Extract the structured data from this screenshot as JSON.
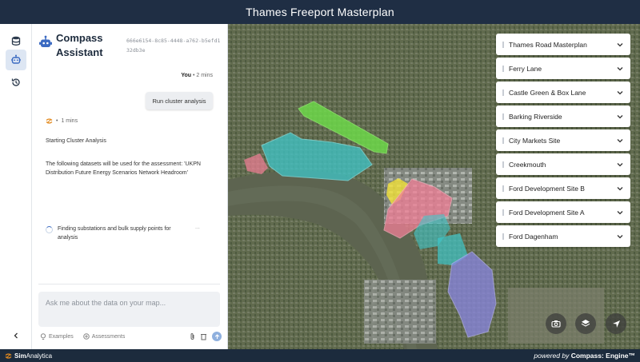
{
  "app": {
    "title": "Thames Freeport Masterplan"
  },
  "assistant": {
    "title": "Compass Assistant",
    "session_id": "666e6154-8c85-4448-a762-b5efd132db3e"
  },
  "conversation": {
    "user": {
      "author": "You",
      "time": "2 mins",
      "message": "Run cluster analysis"
    },
    "bot": {
      "time": "1 mins",
      "heading": "Starting Cluster Analysis",
      "body": "The following datasets will be used for the assessment: 'UKPN Distribution Future Energy Scenarios Network Headroom'",
      "step": "Finding substations and bulk supply points for analysis",
      "step_status": "..."
    }
  },
  "chat_input": {
    "placeholder": "Ask me about the data on your map...",
    "value": "",
    "examples_label": "Examples",
    "assessments_label": "Assessments"
  },
  "sites": [
    {
      "label": "Thames Road Masterplan"
    },
    {
      "label": "Ferry Lane"
    },
    {
      "label": "Castle Green & Box Lane"
    },
    {
      "label": "Barking Riverside"
    },
    {
      "label": "City Markets Site"
    },
    {
      "label": "Creekmouth"
    },
    {
      "label": "Ford Development Site B"
    },
    {
      "label": "Ford Development Site A"
    },
    {
      "label": "Ford Dagenham"
    }
  ],
  "footer": {
    "brand_prefix": "Sim",
    "brand_suffix": "Analytica",
    "powered_prefix": "powered by",
    "powered_engine": "Compass: Engine™"
  },
  "colors": {
    "header_bg": "#1f2e44",
    "accent": "#3c6bc2",
    "zone_green": "#6ee04a",
    "zone_teal": "#3fc6c9",
    "zone_pink": "#f27f97",
    "zone_yellow": "#f2e23a",
    "zone_purple": "#8a86e3"
  }
}
